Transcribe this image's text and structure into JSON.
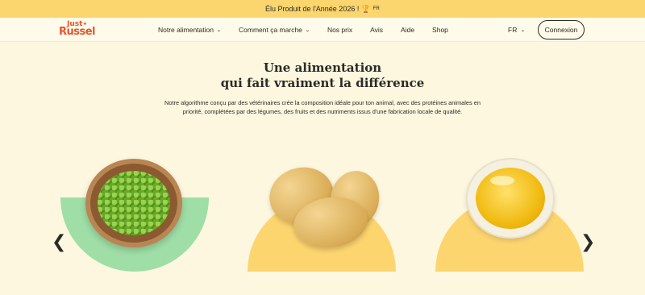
{
  "promo": {
    "text": "Élu Produit de l'Année 2026 !",
    "trophy_icon": "trophy-icon",
    "badge": "FR"
  },
  "nav": {
    "logo_line1": "Just",
    "logo_line2": "Russel",
    "items": [
      {
        "label": "Notre alimentation",
        "dropdown": true
      },
      {
        "label": "Comment ça marche",
        "dropdown": true
      },
      {
        "label": "Nos prix",
        "dropdown": false
      },
      {
        "label": "Avis",
        "dropdown": false
      },
      {
        "label": "Aide",
        "dropdown": false
      },
      {
        "label": "Shop",
        "dropdown": false
      }
    ],
    "language": "FR",
    "login_label": "Connexion"
  },
  "hero": {
    "title_line1": "Une alimentation",
    "title_line2": "qui fait vraiment la différence",
    "description": "Notre algorithme conçu par des vétérinaires crée la composition idéale pour ton animal, avec des protéines animales en priorité, complétées par des légumes, des fruits et des nutriments issus d'une fabrication locale de qualité."
  },
  "carousel": {
    "items": [
      {
        "name": "peas",
        "bg": "#9fdea6"
      },
      {
        "name": "potatoes",
        "bg": "#fdd56f"
      },
      {
        "name": "oil",
        "bg": "#fdd56f"
      }
    ],
    "prev_icon": "chevron-left-icon",
    "next_icon": "chevron-right-icon"
  },
  "colors": {
    "background": "#fdf7df",
    "promo": "#fbd56d",
    "brand": "#e8542d"
  }
}
